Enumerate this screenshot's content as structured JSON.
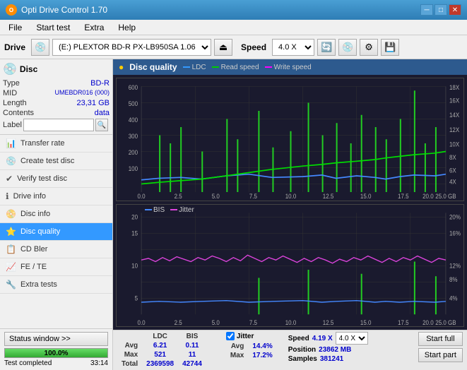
{
  "app": {
    "title": "Opti Drive Control 1.70",
    "logo": "O"
  },
  "titlebar": {
    "title": "Opti Drive Control 1.70",
    "minimize": "─",
    "maximize": "□",
    "close": "✕"
  },
  "menubar": {
    "items": [
      "File",
      "Start test",
      "Extra",
      "Help"
    ]
  },
  "toolbar": {
    "drive_label": "Drive",
    "drive_value": "(E:)  PLEXTOR BD-R  PX-LB950SA 1.06",
    "speed_label": "Speed",
    "speed_value": "4.0 X"
  },
  "disc": {
    "type_label": "Type",
    "type_value": "BD-R",
    "mid_label": "MID",
    "mid_value": "UMEBDR016 (000)",
    "length_label": "Length",
    "length_value": "23,31 GB",
    "contents_label": "Contents",
    "contents_value": "data",
    "label_label": "Label",
    "label_value": ""
  },
  "nav": {
    "items": [
      {
        "id": "transfer-rate",
        "label": "Transfer rate",
        "icon": "📊"
      },
      {
        "id": "create-test-disc",
        "label": "Create test disc",
        "icon": "💿"
      },
      {
        "id": "verify-test-disc",
        "label": "Verify test disc",
        "icon": "✔"
      },
      {
        "id": "drive-info",
        "label": "Drive info",
        "icon": "ℹ"
      },
      {
        "id": "disc-info",
        "label": "Disc info",
        "icon": "📀"
      },
      {
        "id": "disc-quality",
        "label": "Disc quality",
        "icon": "⭐",
        "active": true
      },
      {
        "id": "cd-bler",
        "label": "CD Bler",
        "icon": "📋"
      },
      {
        "id": "fe-te",
        "label": "FE / TE",
        "icon": "📈"
      },
      {
        "id": "extra-tests",
        "label": "Extra tests",
        "icon": "🔧"
      }
    ]
  },
  "chart": {
    "title": "Disc quality",
    "legend": {
      "ldc": "LDC",
      "read": "Read speed",
      "write": "Write speed",
      "bis": "BIS",
      "jitter": "Jitter"
    }
  },
  "stats": {
    "columns": [
      "LDC",
      "BIS",
      "",
      "Jitter",
      "Speed",
      ""
    ],
    "rows": [
      {
        "label": "Avg",
        "ldc": "6.21",
        "bis": "0.11",
        "jitter": "14.4%",
        "speed": "4.19 X",
        "speed_select": "4.0 X"
      },
      {
        "label": "Max",
        "ldc": "521",
        "bis": "11",
        "jitter": "17.2%",
        "position_label": "Position",
        "position_val": "23862 MB"
      },
      {
        "label": "Total",
        "ldc": "2369598",
        "bis": "42744",
        "samples_label": "Samples",
        "samples_val": "381241"
      }
    ],
    "jitter_checked": true,
    "speed_label": "Speed",
    "speed_val": "4.19 X",
    "speed_select": "4.0 X",
    "position_label": "Position",
    "position_val": "23862 MB",
    "samples_label": "Samples",
    "samples_val": "381241"
  },
  "buttons": {
    "start_full": "Start full",
    "start_part": "Start part"
  },
  "status": {
    "window_label": "Status window >>",
    "progress_percent": "100.0%",
    "progress_width": 100,
    "status_text": "Test completed",
    "time": "33:14"
  },
  "colors": {
    "accent_blue": "#3399ff",
    "active_nav": "#3399ff",
    "progress_green": "#44cc44",
    "chart_bg": "#1a1a2e",
    "ldc_color": "#4488ff",
    "read_color": "#00dd00",
    "bis_color": "#44aaff",
    "jitter_color": "#dd44dd",
    "green_spikes": "#22cc22"
  }
}
